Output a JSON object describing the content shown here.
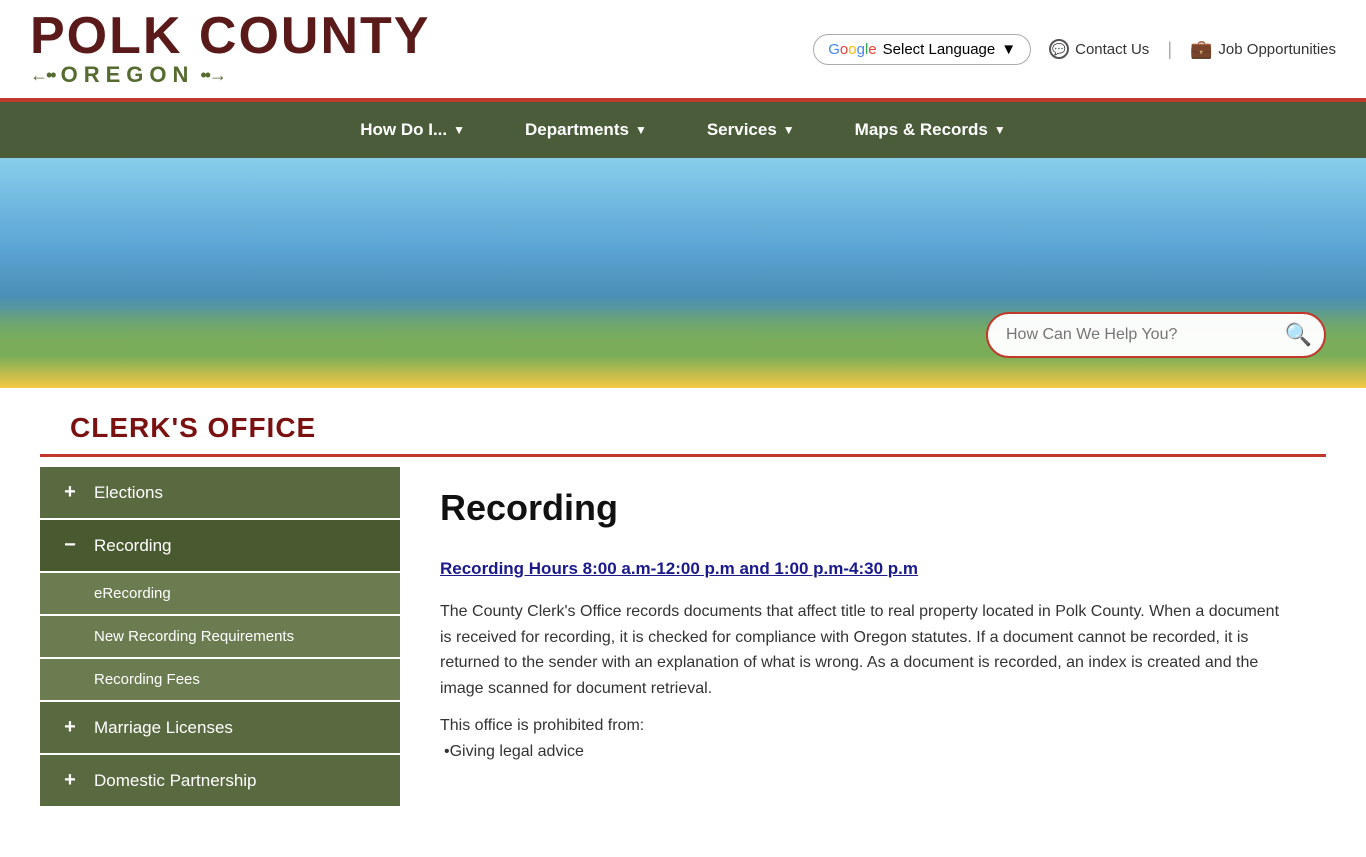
{
  "header": {
    "logo_polk": "POLK COUNTY",
    "logo_oregon": "OREGON",
    "translate_label": "Select Language",
    "contact_label": "Contact Us",
    "jobs_label": "Job Opportunities"
  },
  "nav": {
    "items": [
      {
        "label": "How Do I...",
        "arrow": true
      },
      {
        "label": "Departments",
        "arrow": true
      },
      {
        "label": "Services",
        "arrow": true
      },
      {
        "label": "Maps & Records",
        "arrow": true
      }
    ]
  },
  "search": {
    "placeholder": "How Can We Help You?"
  },
  "dept": {
    "title": "CLERK'S OFFICE"
  },
  "sidebar": {
    "items": [
      {
        "label": "Elections",
        "type": "plus",
        "expanded": false
      },
      {
        "label": "Recording",
        "type": "minus",
        "expanded": true
      },
      {
        "label": "Marriage Licenses",
        "type": "plus",
        "expanded": false
      },
      {
        "label": "Domestic Partnership",
        "type": "plus",
        "expanded": false
      }
    ],
    "sub_items": [
      {
        "label": "eRecording"
      },
      {
        "label": "New Recording Requirements"
      },
      {
        "label": "Recording Fees"
      }
    ]
  },
  "main": {
    "page_title": "Recording",
    "hours_link": "Recording Hours 8:00 a.m-12:00 p.m and 1:00 p.m-4:30 p.m",
    "paragraph1": "The County Clerk's Office records documents that affect title to real property located in Polk County. When a document is received for recording, it is checked for compliance with Oregon statutes. If a document cannot be recorded, it is returned to the sender with an explanation of what is wrong. As a document is recorded, an index is created and the image scanned for document retrieval.",
    "paragraph2": "This office is prohibited from:",
    "prohibited_item1": "•Giving legal advice"
  }
}
